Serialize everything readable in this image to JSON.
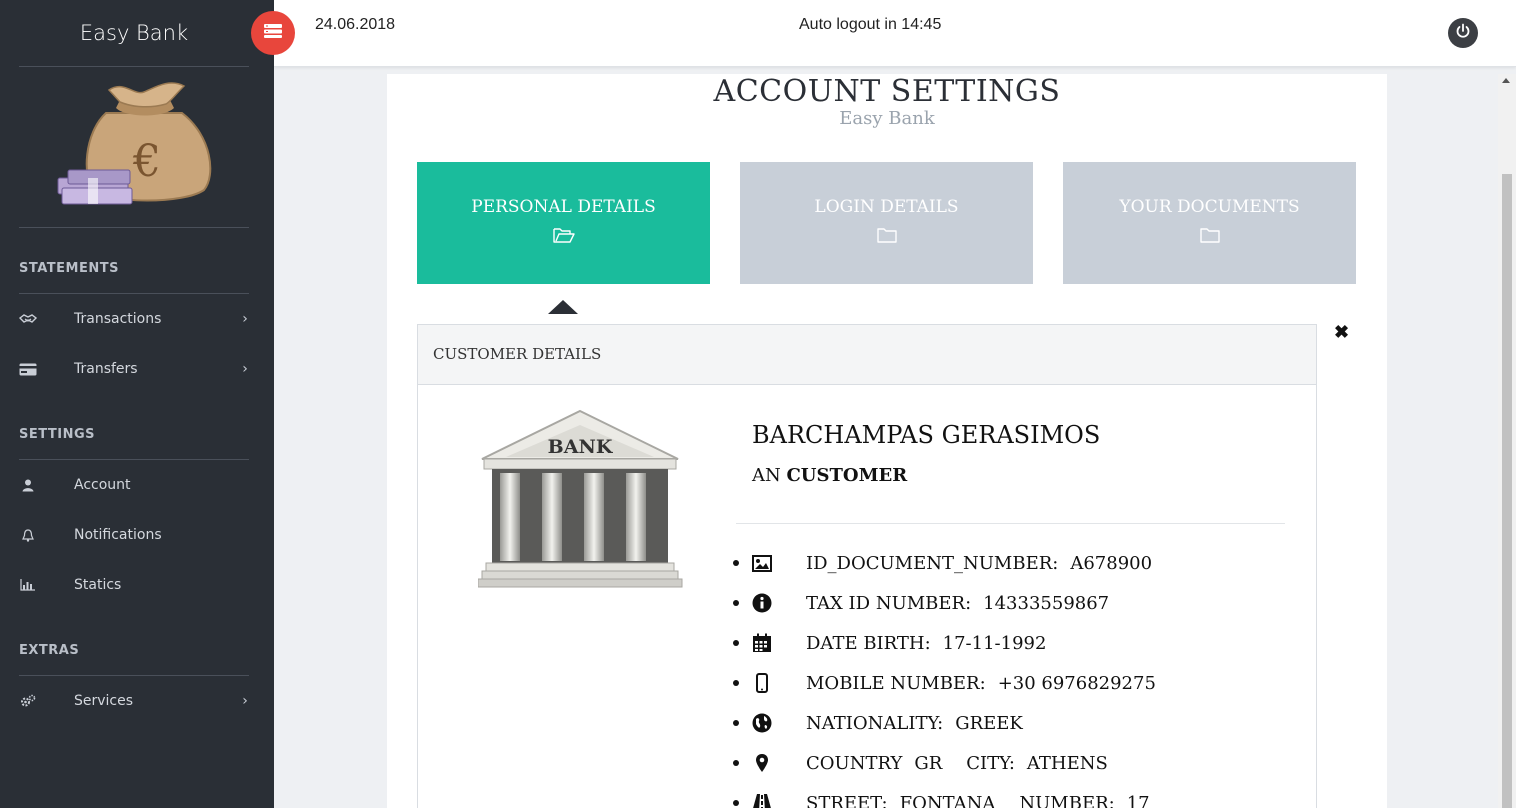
{
  "sidebar": {
    "brand": "Easy Bank",
    "sections": {
      "statements": "STATEMENTS",
      "settings": "SETTINGS",
      "extras": "EXTRAS"
    },
    "items": [
      {
        "label": "Transactions",
        "icon": "handshake-icon",
        "chevron": "›"
      },
      {
        "label": "Transfers",
        "icon": "credit-card-icon",
        "chevron": "›"
      },
      {
        "label": "Account",
        "icon": "user-icon"
      },
      {
        "label": "Notifications",
        "icon": "bell-icon"
      },
      {
        "label": "Statics",
        "icon": "bar-chart-icon"
      },
      {
        "label": "Services",
        "icon": "cogs-icon",
        "chevron": "›"
      }
    ]
  },
  "topbar": {
    "date": "24.06.2018",
    "auto_logout": "Auto logout in 14:45"
  },
  "page": {
    "title": "ACCOUNT SETTINGS",
    "subtitle": "Easy Bank"
  },
  "tabs": [
    {
      "label": "PERSONAL DETAILS",
      "active": true
    },
    {
      "label": "LOGIN DETAILS",
      "active": false
    },
    {
      "label": "YOUR DOCUMENTS",
      "active": false
    }
  ],
  "panel": {
    "heading": "CUSTOMER DETAILS",
    "bank_sign": "BANK",
    "name": "BARCHAMPAS GERASIMOS",
    "role_prefix": "AN",
    "role": "CUSTOMER",
    "details": [
      {
        "label": "ID_DOCUMENT_NUMBER:",
        "value": "A678900"
      },
      {
        "label": "TAX ID NUMBER:",
        "value": "14333559867"
      },
      {
        "label": "DATE BIRTH:",
        "value": "17-11-1992"
      },
      {
        "label": "MOBILE NUMBER:",
        "value": "+30 6976829275"
      },
      {
        "label": "NATIONALITY:",
        "value": "GREEK"
      },
      {
        "label": "COUNTRY",
        "value": "GR",
        "label2": "CITY:",
        "value2": "ATHENS"
      },
      {
        "label": "STREET:",
        "value": "FONTANA",
        "label2": "NUMBER:",
        "value2": "17"
      }
    ]
  },
  "colors": {
    "sidebar_bg": "#2a2f36",
    "accent": "#1abc9c",
    "toggle": "#e8463c",
    "tab_inactive": "#c8cfd8"
  }
}
